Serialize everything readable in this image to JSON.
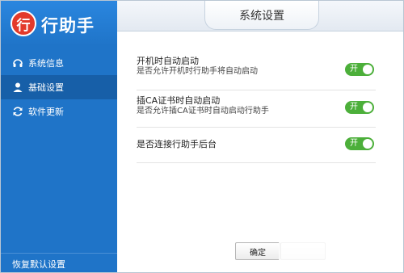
{
  "app": {
    "logo_glyph": "行",
    "name": "行助手"
  },
  "sidebar": {
    "items": [
      {
        "label": "系统信息",
        "icon": "headset-icon"
      },
      {
        "label": "基础设置",
        "icon": "user-icon",
        "active": true
      },
      {
        "label": "软件更新",
        "icon": "refresh-icon"
      }
    ],
    "restore_label": "恢复默认设置"
  },
  "main": {
    "title": "系统设置",
    "settings": [
      {
        "title": "开机时自动启动",
        "description": "是否允许开机时行助手将自动启动",
        "toggle_label": "开",
        "enabled": true
      },
      {
        "title": "插CA证书时自动启动",
        "description": "是否允许插CA证书时自动启动行助手",
        "toggle_label": "开",
        "enabled": true
      },
      {
        "title": "是否连接行助手后台",
        "description": "",
        "toggle_label": "开",
        "enabled": true
      }
    ],
    "ok_label": "确定"
  },
  "colors": {
    "sidebar": "#1f74c8",
    "sidebar_active": "#175fa8",
    "toggle_on": "#4caf3a",
    "logo": "#e33a2a"
  }
}
